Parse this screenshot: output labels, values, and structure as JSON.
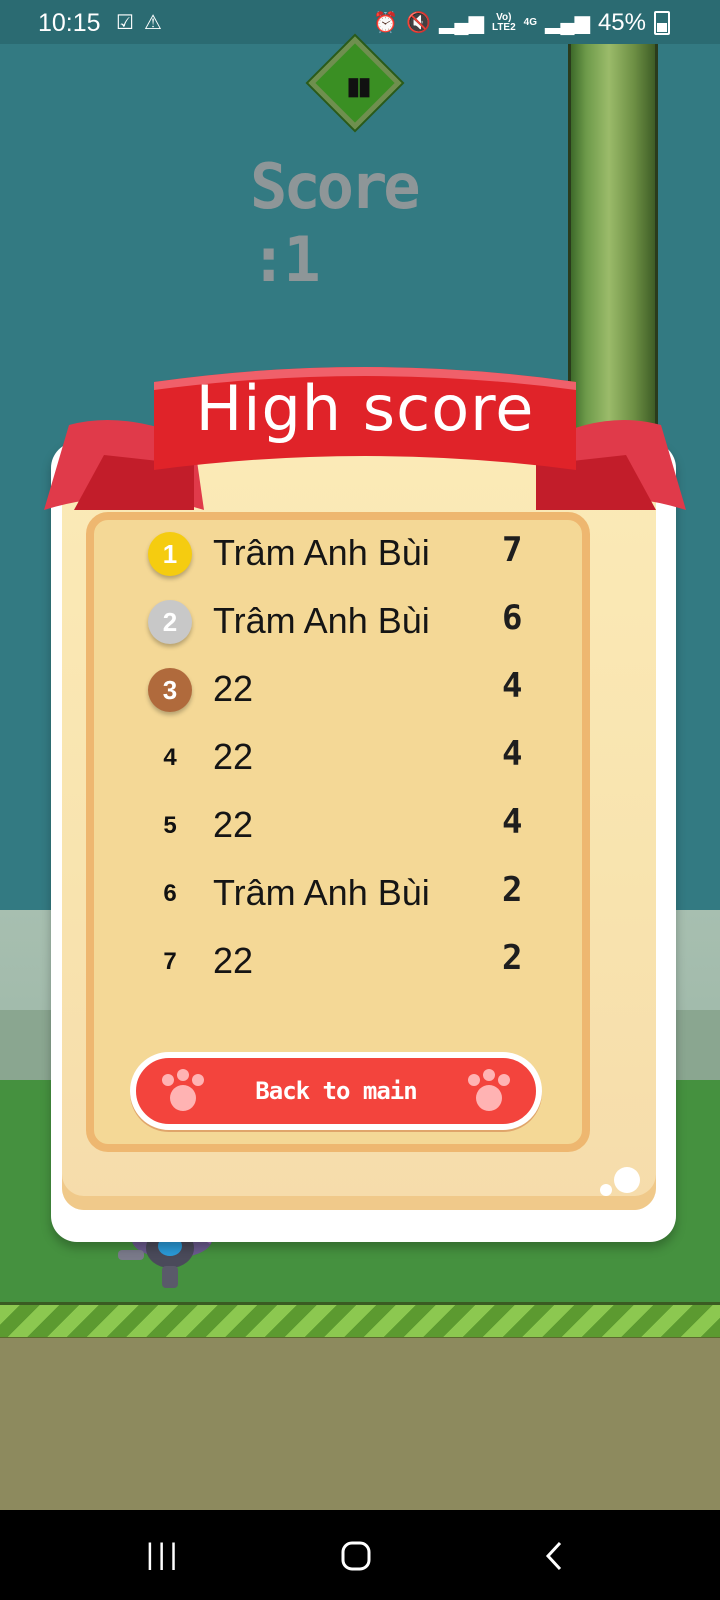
{
  "status_bar": {
    "time": "10:15",
    "left_icons": [
      "check-square-icon",
      "warning-icon"
    ],
    "right_icons": [
      "alarm-icon",
      "mute-icon",
      "signal-icon",
      "volte-icon",
      "4g-icon",
      "signal-icon"
    ],
    "net_label_top": "Vo)",
    "net_label_bottom": "LTE2",
    "net_4g": "4G",
    "battery_percent": "45%"
  },
  "hud": {
    "pause_icon": "pause-icon",
    "score_label": "Score :1"
  },
  "high_score_dialog": {
    "title": "High score",
    "entries": [
      {
        "rank": "1",
        "name": "Trâm Anh Bùi",
        "score": "7"
      },
      {
        "rank": "2",
        "name": "Trâm Anh Bùi",
        "score": "6"
      },
      {
        "rank": "3",
        "name": "22",
        "score": "4"
      },
      {
        "rank": "4",
        "name": "22",
        "score": "4"
      },
      {
        "rank": "5",
        "name": "22",
        "score": "4"
      },
      {
        "rank": "6",
        "name": "Trâm Anh Bùi",
        "score": "2"
      },
      {
        "rank": "7",
        "name": "22",
        "score": "2"
      }
    ],
    "back_button_label": "Back to main",
    "colors": {
      "ribbon": "#e02329",
      "button": "#f3443d",
      "gold": "#f5cc10",
      "silver": "#c8c8c8",
      "bronze": "#b06a3c"
    }
  },
  "nav_bar": {
    "recents_icon": "recents-icon",
    "home_icon": "home-icon",
    "back_icon": "back-icon"
  }
}
